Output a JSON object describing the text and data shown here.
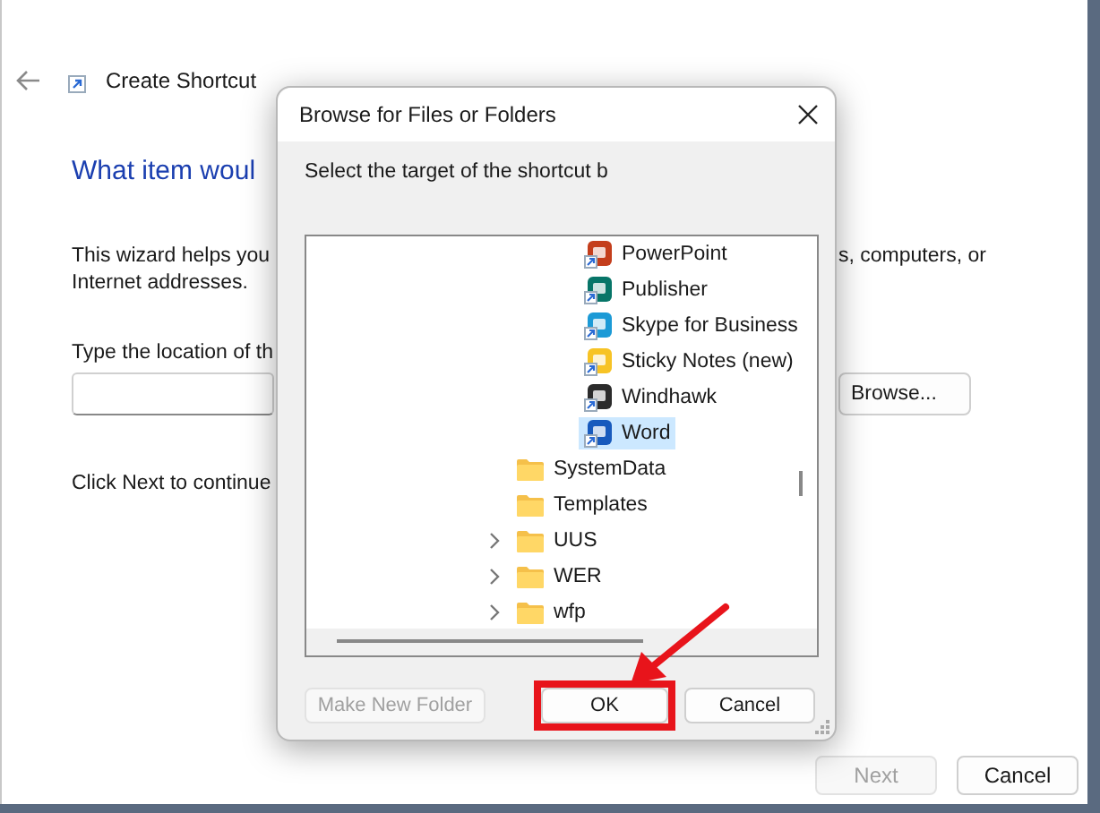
{
  "wizard": {
    "title": "Create Shortcut",
    "heading": "What item woul",
    "intro": [
      {
        "left": "This wizard helps you",
        "right": "s, computers, or"
      },
      {
        "left": "Internet addresses."
      }
    ],
    "location_label": "Type the location of th",
    "browse_button": "Browse...",
    "footer_text": "Click Next to continue",
    "buttons": [
      {
        "label": "Next",
        "disabled": true
      },
      {
        "label": "Cancel",
        "disabled": false
      }
    ]
  },
  "dialog": {
    "title": "Browse for Files or Folders",
    "prompt": "Select the target of the shortcut b",
    "tree": [
      {
        "kind": "group",
        "children": [
          {
            "kind": "shortcut",
            "label": "PowerPoint",
            "color": "#c43e1c",
            "selected": false
          },
          {
            "kind": "shortcut",
            "label": "Publisher",
            "color": "#077568",
            "selected": false
          },
          {
            "kind": "shortcut",
            "label": "Skype for Business",
            "color": "#1c9ad6",
            "selected": false
          },
          {
            "kind": "shortcut",
            "label": "Sticky Notes (new)",
            "color": "#f7c325",
            "selected": false
          },
          {
            "kind": "shortcut",
            "label": "Windhawk",
            "color": "#2b2b2b",
            "selected": false
          },
          {
            "kind": "shortcut",
            "label": "Word",
            "color": "#185abd",
            "selected": true
          }
        ]
      },
      {
        "kind": "folder",
        "label": "SystemData",
        "expandable": false,
        "selected": false
      },
      {
        "kind": "folder",
        "label": "Templates",
        "expandable": false,
        "selected": false
      },
      {
        "kind": "folder",
        "label": "UUS",
        "expandable": true,
        "selected": false
      },
      {
        "kind": "folder",
        "label": "WER",
        "expandable": true,
        "selected": false
      },
      {
        "kind": "folder",
        "label": "wfp",
        "expandable": true,
        "selected": false
      }
    ],
    "buttons": [
      {
        "label": "Make New Folder",
        "disabled": true,
        "highlighted": false
      },
      {
        "label": "OK",
        "disabled": false,
        "highlighted": true
      },
      {
        "label": "Cancel",
        "disabled": false,
        "highlighted": false
      }
    ]
  }
}
